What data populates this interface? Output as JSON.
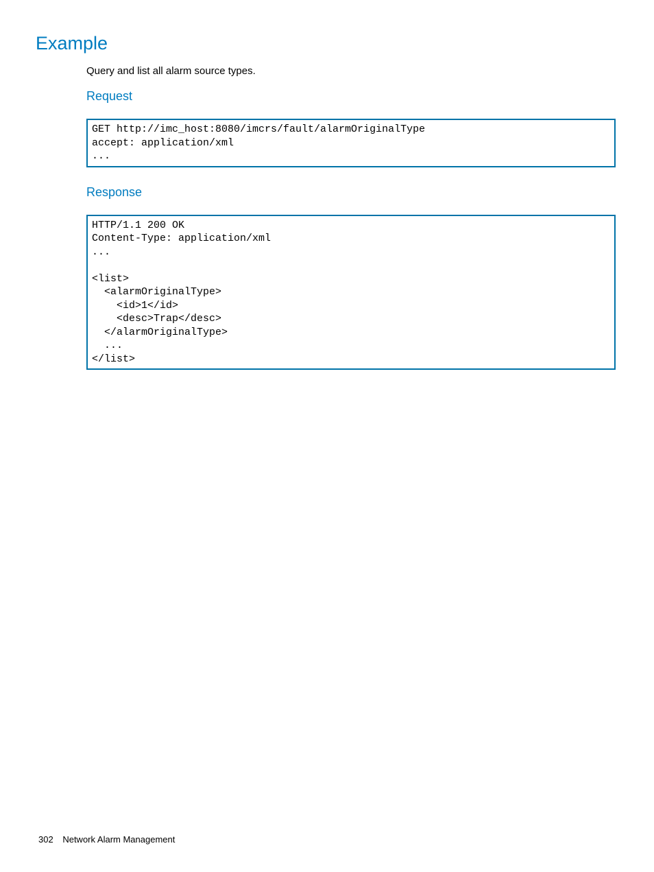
{
  "headings": {
    "example": "Example",
    "request": "Request",
    "response": "Response"
  },
  "intro": "Query and list all alarm source types.",
  "request_code": "GET http://imc_host:8080/imcrs/fault/alarmOriginalType\naccept: application/xml\n...",
  "response_code": "HTTP/1.1 200 OK\nContent-Type: application/xml\n...\n\n<list>\n  <alarmOriginalType>\n    <id>1</id>\n    <desc>Trap</desc>\n  </alarmOriginalType>\n  ...\n</list>",
  "footer": {
    "page_number": "302",
    "section": "Network Alarm Management"
  }
}
